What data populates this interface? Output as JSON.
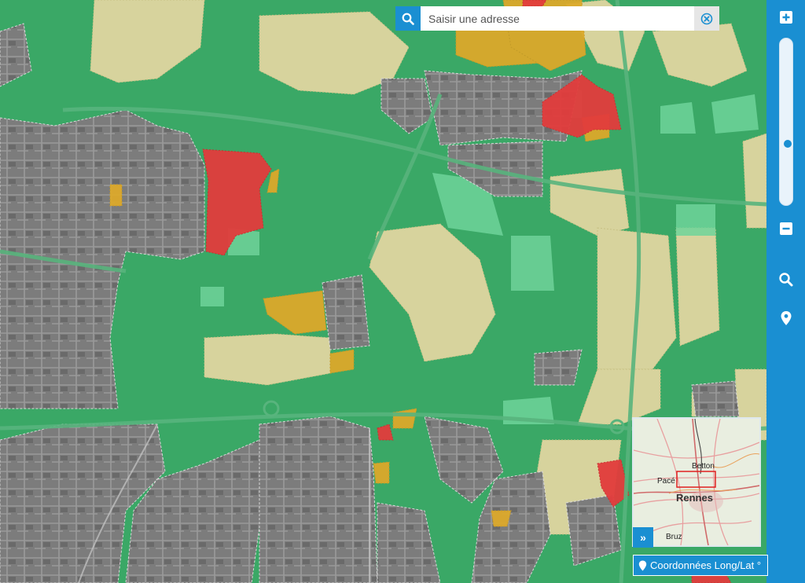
{
  "search": {
    "placeholder": "Saisir une adresse"
  },
  "toolbar": {
    "icons": [
      "search-icon",
      "plus-icon",
      "minus-icon",
      "magnifier-icon",
      "location-pin-icon",
      "close-circle-icon"
    ],
    "zoom_level": 0.64
  },
  "overview": {
    "labels": {
      "betton": "Betton",
      "pace": "Pacé",
      "rennes": "Rennes",
      "bruz": "Bruz"
    },
    "toggle_label": "»"
  },
  "coordinates": {
    "label": "Coordonnées Long/Lat °"
  },
  "colors": {
    "accent": "#1a8fd2",
    "green_zone": "#3aa866",
    "light_green_zone": "#6fd39a",
    "yellow_zone": "#e0d6a0",
    "orange_zone": "#dca92b",
    "red_zone": "#e23c3c",
    "urban": "#7e7e7e"
  }
}
